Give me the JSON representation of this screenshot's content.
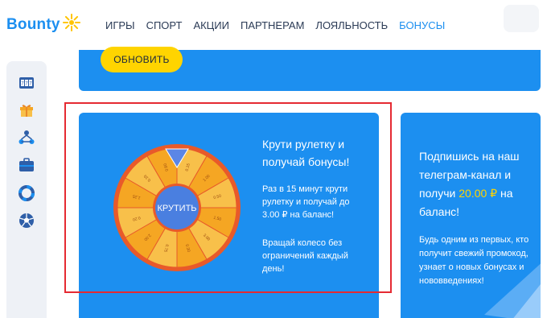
{
  "brand": {
    "name": "Bounty",
    "color": "#1c8ff0",
    "accent": "#ffd400"
  },
  "nav": {
    "items": [
      {
        "label": "ИГРЫ",
        "active": false
      },
      {
        "label": "СПОРТ",
        "active": false
      },
      {
        "label": "АКЦИИ",
        "active": false
      },
      {
        "label": "ПАРТНЕРАМ",
        "active": false
      },
      {
        "label": "ЛОЯЛЬНОСТЬ",
        "active": false
      },
      {
        "label": "БОНУСЫ",
        "active": true
      }
    ]
  },
  "sidebar": {
    "icons": [
      "slots-icon",
      "gift-icon",
      "tournament-icon",
      "briefcase-icon",
      "lifebuoy-icon",
      "soccer-ball-icon"
    ]
  },
  "top_card": {
    "update_label": "ОБНОВИТЬ"
  },
  "wheel_card": {
    "spin_label": "КРУТИТЬ",
    "title": "Крути рулетку и получай бонусы!",
    "description": "Раз в 15 минут крути рулетку и получай до 3.00 ₽ на баланс!",
    "description2": "Вращай колесо без ограничений каждый день!",
    "segment_labels": [
      "0.15",
      "1.00",
      "0.50",
      "1.50",
      "3.00",
      "0.30",
      "0.75",
      "2.00",
      "0.20",
      "1.25",
      "0.10",
      "0.60"
    ],
    "colors": {
      "wheel_outer": "#f5a623",
      "wheel_inner": "#f8c04a",
      "hub": "#4a7fe0",
      "rim": "#e85a2a"
    }
  },
  "telegram_card": {
    "title_before": "Подпишись на наш телеграм-канал и получи",
    "amount": "20.00 ₽",
    "title_after": "на баланс!",
    "description": "Будь одним из первых, кто получит свежий промокод, узнает о новых бонусах и нововведениях!"
  },
  "highlight": {
    "color": "#e52a32"
  }
}
